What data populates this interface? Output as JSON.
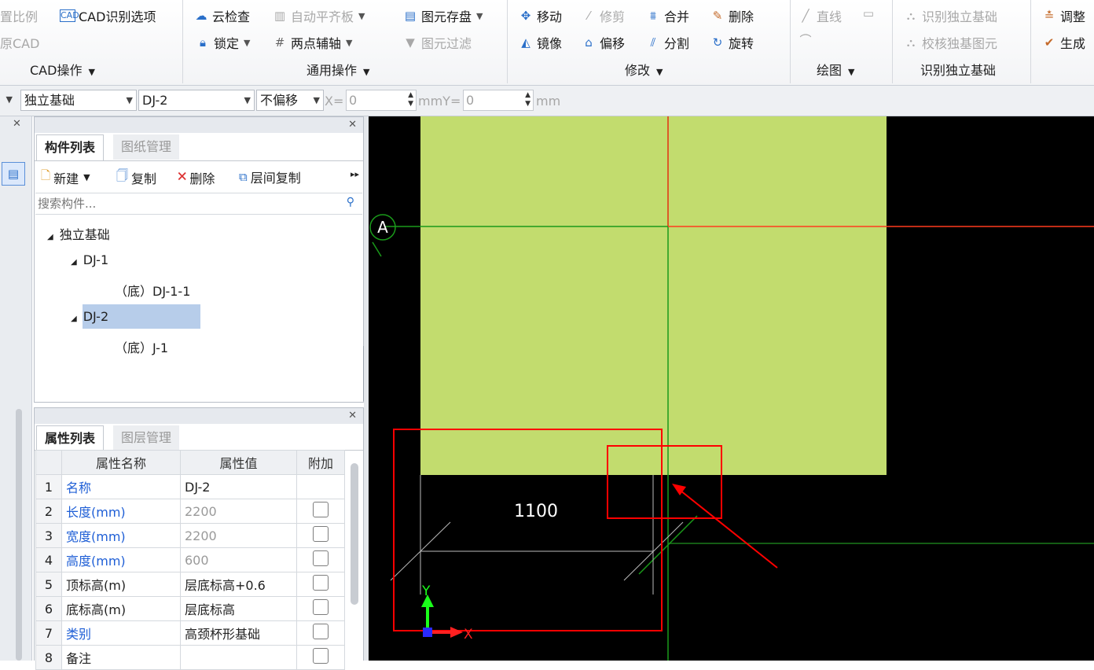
{
  "ribbon": {
    "cad_group": {
      "item_top": "置比例",
      "item_cad_options": "CAD识别选项",
      "item_original_cad": "原CAD",
      "label": "CAD操作"
    },
    "general_group": {
      "cloud_check": "云检查",
      "auto_align": "自动平齐板",
      "element_save": "图元存盘",
      "lock": "锁定",
      "two_point_axis": "两点辅轴",
      "element_filter": "图元过滤",
      "label": "通用操作"
    },
    "modify_group": {
      "move": "移动",
      "trim": "修剪",
      "merge": "合并",
      "delete": "删除",
      "mirror": "镜像",
      "offset": "偏移",
      "split": "分割",
      "rotate": "旋转",
      "label": "修改"
    },
    "draw_group": {
      "line": "直线",
      "label": "绘图"
    },
    "identify_group": {
      "identify": "识别独立基础",
      "check": "校核独基图元",
      "label": "识别独立基础"
    },
    "extra_group": {
      "adjust": "调整",
      "generate": "生成"
    }
  },
  "toolbar": {
    "type_combo": "独立基础",
    "component_combo": "DJ-2",
    "offset_combo": "不偏移",
    "x_label": "X=",
    "x_value": "0",
    "mm_y_label": "mmY=",
    "y_value": "0",
    "mm_label": "mm"
  },
  "component_panel": {
    "tab_components": "构件列表",
    "tab_drawings": "图纸管理",
    "new_btn": "新建",
    "copy_btn": "复制",
    "delete_btn": "删除",
    "floor_copy_btn": "层间复制",
    "search_placeholder": "搜索构件...",
    "tree": {
      "root": "独立基础",
      "dj1": "DJ-1",
      "dj1_child": "（底）DJ-1-1",
      "dj2": "DJ-2",
      "dj2_child": "（底）J-1"
    }
  },
  "property_panel": {
    "tab_props": "属性列表",
    "tab_layers": "图层管理",
    "headers": [
      "属性名称",
      "属性值",
      "附加"
    ],
    "rows": [
      {
        "no": "1",
        "name": "名称",
        "value": "DJ-2",
        "blue": true,
        "gray": false,
        "check": false
      },
      {
        "no": "2",
        "name": "长度(mm)",
        "value": "2200",
        "blue": true,
        "gray": true,
        "check": true
      },
      {
        "no": "3",
        "name": "宽度(mm)",
        "value": "2200",
        "blue": true,
        "gray": true,
        "check": true
      },
      {
        "no": "4",
        "name": "高度(mm)",
        "value": "600",
        "blue": true,
        "gray": true,
        "check": true
      },
      {
        "no": "5",
        "name": "顶标高(m)",
        "value": "层底标高+0.6",
        "blue": false,
        "gray": false,
        "check": true
      },
      {
        "no": "6",
        "name": "底标高(m)",
        "value": "层底标高",
        "blue": false,
        "gray": false,
        "check": true
      },
      {
        "no": "7",
        "name": "类别",
        "value": "高颈杯形基础",
        "blue": true,
        "gray": false,
        "check": true
      },
      {
        "no": "8",
        "name": "备注",
        "value": "",
        "blue": false,
        "gray": false,
        "check": true
      }
    ]
  },
  "canvas": {
    "axis_label": "A",
    "dimension": "1100",
    "y_axis": "Y",
    "x_axis": "X"
  },
  "colors": {
    "foundation_fill": "#c2dc6e",
    "highlight": "#ff0000",
    "axis_green": "#1a9a1a"
  }
}
